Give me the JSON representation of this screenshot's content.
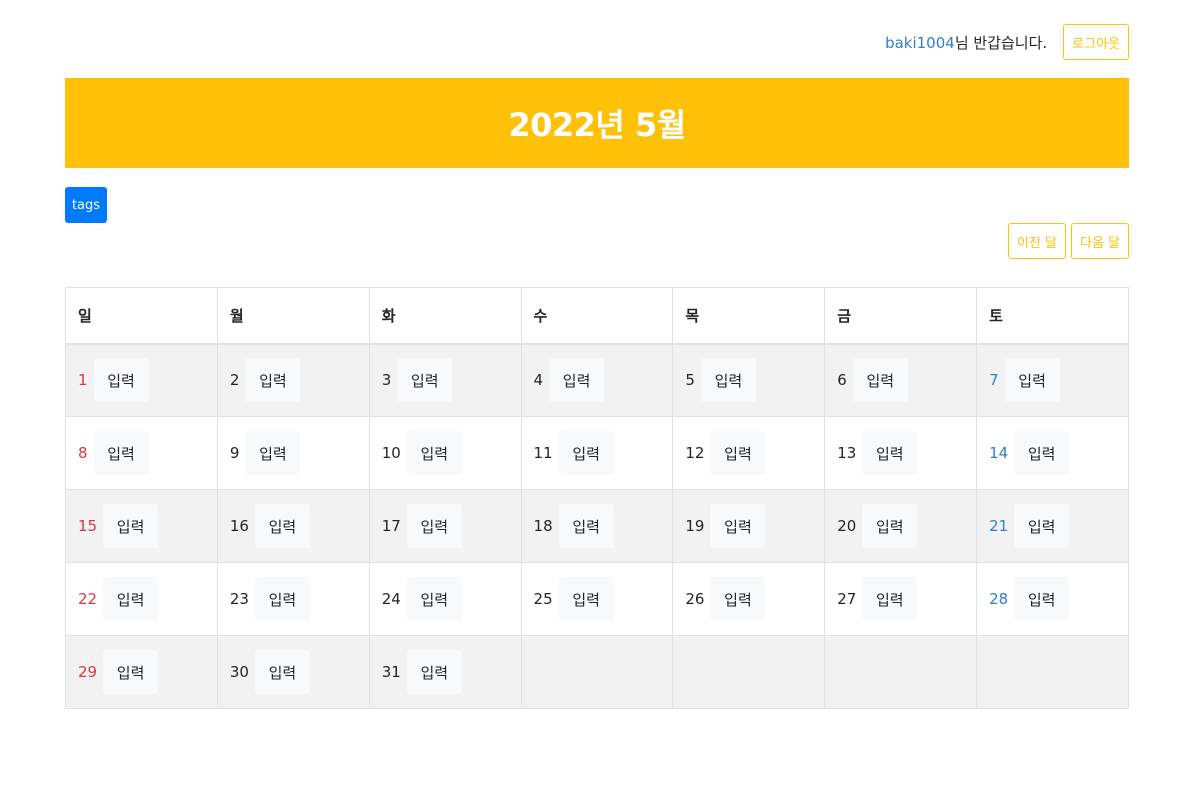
{
  "header": {
    "username": "baki1004",
    "greeting_suffix": "님 반갑습니다.",
    "logout_label": "로그아웃"
  },
  "banner": {
    "title": "2022년 5월"
  },
  "tags_label": "tags",
  "nav": {
    "prev_label": "이전 달",
    "next_label": "다음 달"
  },
  "colors": {
    "accent": "#ffc107",
    "primary": "#007bff",
    "sunday": "#dc3545",
    "saturday": "#2f7fd0"
  },
  "calendar": {
    "weekdays": [
      "일",
      "월",
      "화",
      "수",
      "목",
      "금",
      "토"
    ],
    "input_label": "입력",
    "weeks": [
      [
        "1",
        "2",
        "3",
        "4",
        "5",
        "6",
        "7"
      ],
      [
        "8",
        "9",
        "10",
        "11",
        "12",
        "13",
        "14"
      ],
      [
        "15",
        "16",
        "17",
        "18",
        "19",
        "20",
        "21"
      ],
      [
        "22",
        "23",
        "24",
        "25",
        "26",
        "27",
        "28"
      ],
      [
        "29",
        "30",
        "31",
        "",
        "",
        "",
        ""
      ]
    ]
  }
}
